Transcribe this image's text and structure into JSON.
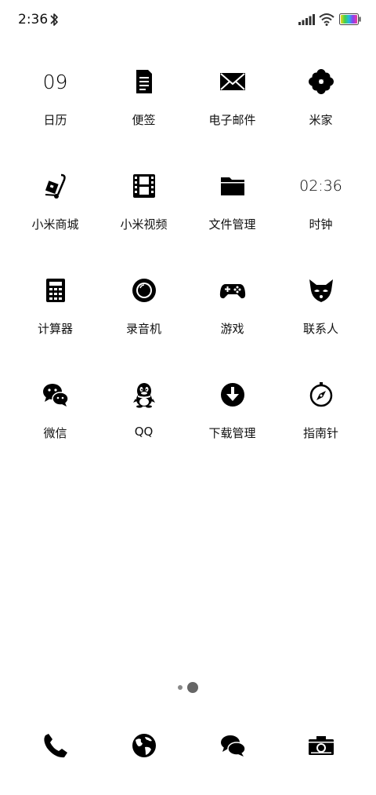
{
  "status_bar": {
    "time": "2:36",
    "icons": [
      "bluetooth-icon",
      "signal-icon",
      "wifi-icon",
      "battery-icon"
    ]
  },
  "apps": [
    {
      "label": "日历",
      "icon": "calendar-icon",
      "icon_text": "09"
    },
    {
      "label": "便签",
      "icon": "notes-icon"
    },
    {
      "label": "电子邮件",
      "icon": "mail-icon"
    },
    {
      "label": "米家",
      "icon": "mijia-flower-icon"
    },
    {
      "label": "小米商城",
      "icon": "mall-cart-icon"
    },
    {
      "label": "小米视频",
      "icon": "film-icon"
    },
    {
      "label": "文件管理",
      "icon": "folder-icon"
    },
    {
      "label": "时钟",
      "icon": "clock-icon",
      "icon_text": "02:36"
    },
    {
      "label": "计算器",
      "icon": "calculator-icon"
    },
    {
      "label": "录音机",
      "icon": "recorder-icon"
    },
    {
      "label": "游戏",
      "icon": "gamepad-icon"
    },
    {
      "label": "联系人",
      "icon": "contacts-fox-icon"
    },
    {
      "label": "微信",
      "icon": "wechat-icon"
    },
    {
      "label": "QQ",
      "icon": "qq-penguin-icon"
    },
    {
      "label": "下载管理",
      "icon": "download-icon"
    },
    {
      "label": "指南针",
      "icon": "compass-icon"
    }
  ],
  "page_indicator": {
    "pages": 2,
    "current": 2
  },
  "dock": [
    {
      "icon": "phone-icon"
    },
    {
      "icon": "browser-globe-icon"
    },
    {
      "icon": "messages-icon"
    },
    {
      "icon": "camera-icon"
    }
  ],
  "colors": {
    "background": "#ffffff",
    "icon": "#000000",
    "text": "#111111"
  }
}
